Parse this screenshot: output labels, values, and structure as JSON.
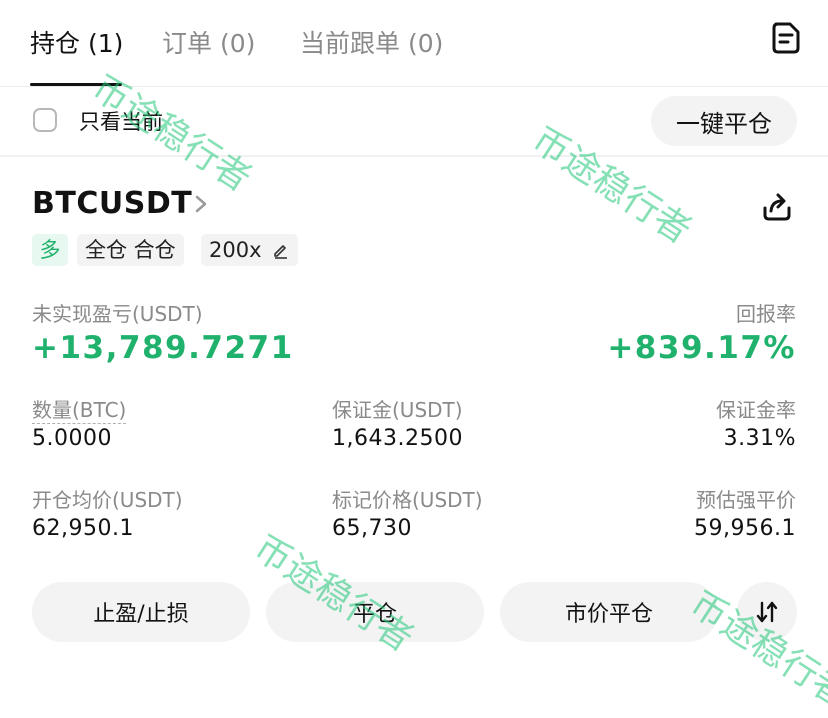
{
  "tabs": [
    {
      "label": "持仓 (1)",
      "active": true
    },
    {
      "label": "订单 (0)",
      "active": false
    },
    {
      "label": "当前跟单 (0)",
      "active": false
    }
  ],
  "header_icon": "document-list-icon",
  "filter": {
    "checkbox_label": "只看当前",
    "checked": false,
    "close_all_label": "一键平仓"
  },
  "position": {
    "symbol": "BTCUSDT",
    "tags": {
      "side": "多",
      "margin_mode": "全仓 合仓",
      "leverage": "200x"
    },
    "unrealized_pnl_label": "未实现盈亏(USDT)",
    "unrealized_pnl": "+13,789.7271",
    "roe_label": "回报率",
    "roe": "+839.17%",
    "fields": {
      "qty_label": "数量(BTC)",
      "qty": "5.0000",
      "margin_label": "保证金(USDT)",
      "margin": "1,643.2500",
      "margin_ratio_label": "保证金率",
      "margin_ratio": "3.31%",
      "entry_label": "开仓均价(USDT)",
      "entry": "62,950.1",
      "mark_label": "标记价格(USDT)",
      "mark": "65,730",
      "liq_label": "预估强平价",
      "liq": "59,956.1"
    }
  },
  "actions": {
    "tpsl": "止盈/止损",
    "close": "平仓",
    "market_close": "市价平仓"
  },
  "watermark": "币途稳行者",
  "colors": {
    "accent_green": "#20b26c",
    "watermark": "#22c77a",
    "button_bg": "#f3f3f3"
  }
}
